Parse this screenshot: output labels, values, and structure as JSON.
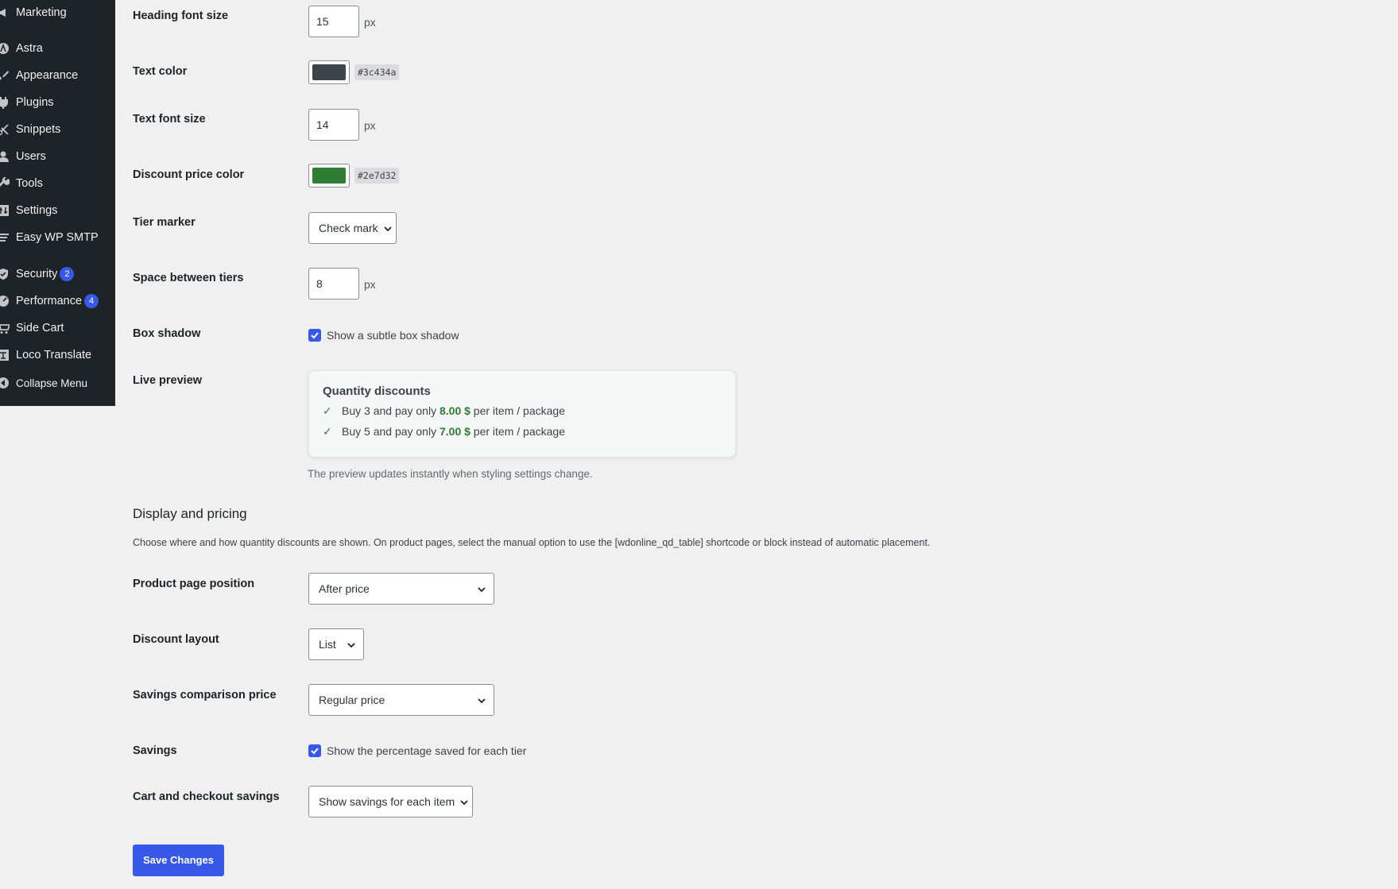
{
  "sidebar": {
    "items": [
      {
        "label": "Marketing",
        "icon": "megaphone-icon"
      },
      {
        "label": "Astra",
        "icon": "astra-icon"
      },
      {
        "label": "Appearance",
        "icon": "paintbrush-icon"
      },
      {
        "label": "Plugins",
        "icon": "plugin-icon"
      },
      {
        "label": "Snippets",
        "icon": "scissors-icon"
      },
      {
        "label": "Users",
        "icon": "user-icon"
      },
      {
        "label": "Tools",
        "icon": "wrench-icon"
      },
      {
        "label": "Settings",
        "icon": "settings-icon"
      },
      {
        "label": "Easy WP SMTP",
        "icon": "mail-icon"
      },
      {
        "label": "Security",
        "icon": "shield-icon",
        "badge": "2"
      },
      {
        "label": "Performance",
        "icon": "gauge-icon",
        "badge": "4"
      },
      {
        "label": "Side Cart",
        "icon": "cart-icon"
      },
      {
        "label": "Loco Translate",
        "icon": "translate-icon"
      },
      {
        "label": "Collapse Menu",
        "icon": "collapse-icon"
      }
    ]
  },
  "styling": {
    "heading_font_size": {
      "label": "Heading font size",
      "value": "15",
      "unit": "px"
    },
    "text_color": {
      "label": "Text color",
      "value": "#3c434a"
    },
    "text_font_size": {
      "label": "Text font size",
      "value": "14",
      "unit": "px"
    },
    "discount_price_color": {
      "label": "Discount price color",
      "value": "#2e7d32"
    },
    "tier_marker": {
      "label": "Tier marker",
      "value": "Check mark"
    },
    "space_between_tiers": {
      "label": "Space between tiers",
      "value": "8",
      "unit": "px"
    },
    "box_shadow": {
      "label": "Box shadow",
      "checkbox_label": "Show a subtle box shadow",
      "checked": true
    },
    "live_preview": {
      "label": "Live preview",
      "title": "Quantity discounts",
      "marker": "✓",
      "tiers": [
        {
          "prefix": "Buy 3 and pay only ",
          "price": "8.00 $",
          "suffix": " per item / package"
        },
        {
          "prefix": "Buy 5 and pay only ",
          "price": "7.00 $",
          "suffix": " per item / package"
        }
      ],
      "hint": "The preview updates instantly when styling settings change."
    }
  },
  "display": {
    "title": "Display and pricing",
    "description": "Choose where and how quantity discounts are shown. On product pages, select the manual option to use the [wdonline_qd_table] shortcode or block instead of automatic placement.",
    "product_page_position": {
      "label": "Product page position",
      "value": "After price"
    },
    "discount_layout": {
      "label": "Discount layout",
      "value": "List"
    },
    "savings_comparison_price": {
      "label": "Savings comparison price",
      "value": "Regular price"
    },
    "savings": {
      "label": "Savings",
      "checkbox_label": "Show the percentage saved for each tier",
      "checked": true
    },
    "cart_checkout_savings": {
      "label": "Cart and checkout savings",
      "value": "Show savings for each item"
    }
  },
  "save_button": "Save Changes"
}
